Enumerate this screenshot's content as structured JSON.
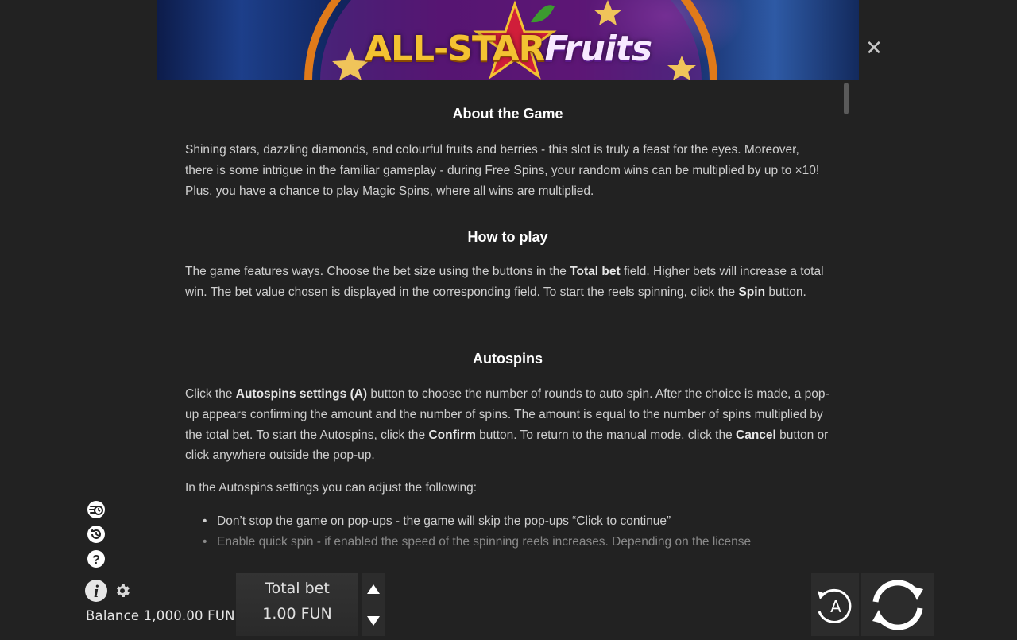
{
  "banner": {
    "logo_part1": "ALL-STAR",
    "logo_part2": "Fruits"
  },
  "sections": {
    "about": {
      "title": "About the Game",
      "text": "Shining stars, dazzling diamonds, and colourful fruits and berries - this slot is truly a feast for the eyes. Moreover, there is some intrigue in the familiar gameplay - during Free Spins, your random wins can be multiplied by up to ×10! Plus, you have a chance to play Magic Spins, where all wins are multiplied."
    },
    "howto": {
      "title": "How to play",
      "t1": "The game features ways. Choose the bet size using the buttons in the ",
      "b1": "Total bet",
      "t2": " field. Higher bets will increase a total win. The bet value chosen is displayed in the corresponding field. To start the reels spinning, click the ",
      "b2": "Spin",
      "t3": " button."
    },
    "autospins": {
      "title": "Autospins",
      "t1": "Click the ",
      "b1": "Autospins settings (A)",
      "t2": " button to choose the number of rounds to auto spin. After the choice is made, a pop-up appears confirming the amount and the number of spins. The amount is equal to the number of spins multiplied by the total bet. To start the Autospins, click the ",
      "b2": "Confirm",
      "t3": " button. To return to the manual mode, click the ",
      "b3": "Cancel",
      "t4": " button or click anywhere outside the pop-up.",
      "settings_intro": "In the Autospins settings you can adjust the following:",
      "items": [
        "Don’t stop the game on pop-ups - the game will skip the pop-ups “Click to continue”",
        "Enable quick spin - if enabled the speed of the spinning reels increases. Depending on the license"
      ]
    }
  },
  "footer": {
    "balance": "Balance 1,000.00 FUN",
    "total_bet_label": "Total bet",
    "total_bet_value": "1.00 FUN",
    "autospin_letter": "A"
  },
  "colors": {
    "background": "#222222",
    "heading": "#ffffff",
    "body_text": "#cfcfcf",
    "logo_gold": "#f3c232"
  }
}
